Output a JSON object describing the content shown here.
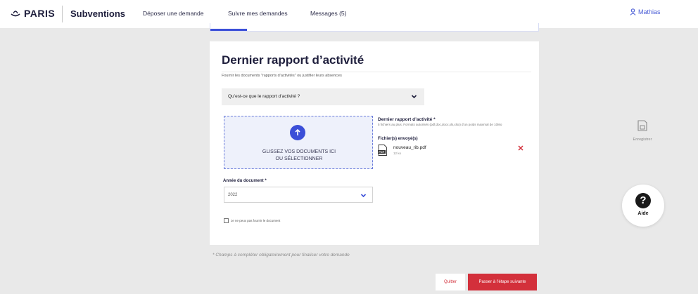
{
  "header": {
    "logo_text": "PARIS",
    "app_title": "Subventions",
    "nav": [
      "Déposer une demande",
      "Suivre mes demandes",
      "Messages (5)"
    ],
    "user_name": "Mathias"
  },
  "card": {
    "title": "Dernier rapport d’activité",
    "description": "Fournir les documents \"rapports d’activités\" ou justifier leurs absences",
    "faq_label": "Qu’est-ce que le rapport d’activité ?",
    "dropzone_line1": "GLISSEZ VOS DOCUMENTS ICI",
    "dropzone_line2": "OU SÉLECTIONNER",
    "document_title": "Dernier rapport d’activité *",
    "document_hint": "5 fichiers au plus. Formats autorisés (pdf,doc,docx,xls,xlsx) d’un poids maximal de 10Mo",
    "sent_files_label": "Fichier(s) envoyé(s)",
    "file": {
      "name": "nouveau_rib.pdf",
      "size": "12 ko",
      "type_label": "PDF"
    },
    "year_label": "Année du document *",
    "year_value": "2022",
    "checkbox_label": "Je ne peux pas fournir le document",
    "checkbox_checked": false
  },
  "mandatory_note": "* Champs à compléter obligatoirement pour finaliser votre demande",
  "tools": {
    "save_label": "Enregistrer",
    "help_label": "Aide"
  },
  "actions": {
    "quit_label": "Quitter",
    "next_label": "Passer à l’étape suivante"
  },
  "colors": {
    "primary": "#3b4fd8",
    "danger": "#d3303b",
    "background": "#e9e9e9"
  }
}
